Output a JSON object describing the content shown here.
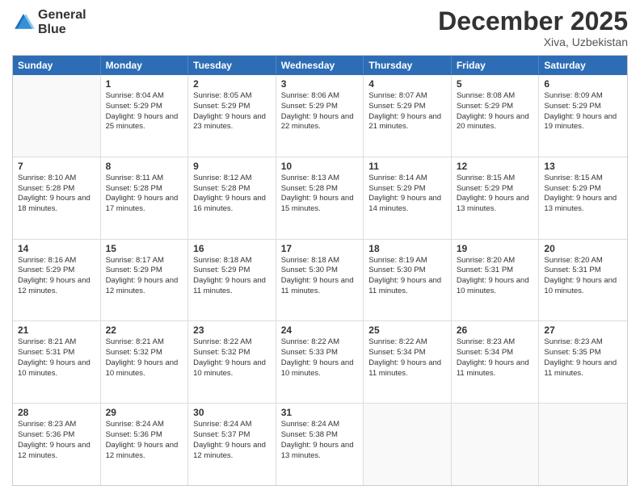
{
  "logo": {
    "line1": "General",
    "line2": "Blue"
  },
  "title": "December 2025",
  "location": "Xiva, Uzbekistan",
  "header_days": [
    "Sunday",
    "Monday",
    "Tuesday",
    "Wednesday",
    "Thursday",
    "Friday",
    "Saturday"
  ],
  "weeks": [
    [
      {
        "day": "",
        "sunrise": "",
        "sunset": "",
        "daylight": ""
      },
      {
        "day": "1",
        "sunrise": "Sunrise: 8:04 AM",
        "sunset": "Sunset: 5:29 PM",
        "daylight": "Daylight: 9 hours and 25 minutes."
      },
      {
        "day": "2",
        "sunrise": "Sunrise: 8:05 AM",
        "sunset": "Sunset: 5:29 PM",
        "daylight": "Daylight: 9 hours and 23 minutes."
      },
      {
        "day": "3",
        "sunrise": "Sunrise: 8:06 AM",
        "sunset": "Sunset: 5:29 PM",
        "daylight": "Daylight: 9 hours and 22 minutes."
      },
      {
        "day": "4",
        "sunrise": "Sunrise: 8:07 AM",
        "sunset": "Sunset: 5:29 PM",
        "daylight": "Daylight: 9 hours and 21 minutes."
      },
      {
        "day": "5",
        "sunrise": "Sunrise: 8:08 AM",
        "sunset": "Sunset: 5:29 PM",
        "daylight": "Daylight: 9 hours and 20 minutes."
      },
      {
        "day": "6",
        "sunrise": "Sunrise: 8:09 AM",
        "sunset": "Sunset: 5:29 PM",
        "daylight": "Daylight: 9 hours and 19 minutes."
      }
    ],
    [
      {
        "day": "7",
        "sunrise": "Sunrise: 8:10 AM",
        "sunset": "Sunset: 5:28 PM",
        "daylight": "Daylight: 9 hours and 18 minutes."
      },
      {
        "day": "8",
        "sunrise": "Sunrise: 8:11 AM",
        "sunset": "Sunset: 5:28 PM",
        "daylight": "Daylight: 9 hours and 17 minutes."
      },
      {
        "day": "9",
        "sunrise": "Sunrise: 8:12 AM",
        "sunset": "Sunset: 5:28 PM",
        "daylight": "Daylight: 9 hours and 16 minutes."
      },
      {
        "day": "10",
        "sunrise": "Sunrise: 8:13 AM",
        "sunset": "Sunset: 5:28 PM",
        "daylight": "Daylight: 9 hours and 15 minutes."
      },
      {
        "day": "11",
        "sunrise": "Sunrise: 8:14 AM",
        "sunset": "Sunset: 5:29 PM",
        "daylight": "Daylight: 9 hours and 14 minutes."
      },
      {
        "day": "12",
        "sunrise": "Sunrise: 8:15 AM",
        "sunset": "Sunset: 5:29 PM",
        "daylight": "Daylight: 9 hours and 13 minutes."
      },
      {
        "day": "13",
        "sunrise": "Sunrise: 8:15 AM",
        "sunset": "Sunset: 5:29 PM",
        "daylight": "Daylight: 9 hours and 13 minutes."
      }
    ],
    [
      {
        "day": "14",
        "sunrise": "Sunrise: 8:16 AM",
        "sunset": "Sunset: 5:29 PM",
        "daylight": "Daylight: 9 hours and 12 minutes."
      },
      {
        "day": "15",
        "sunrise": "Sunrise: 8:17 AM",
        "sunset": "Sunset: 5:29 PM",
        "daylight": "Daylight: 9 hours and 12 minutes."
      },
      {
        "day": "16",
        "sunrise": "Sunrise: 8:18 AM",
        "sunset": "Sunset: 5:29 PM",
        "daylight": "Daylight: 9 hours and 11 minutes."
      },
      {
        "day": "17",
        "sunrise": "Sunrise: 8:18 AM",
        "sunset": "Sunset: 5:30 PM",
        "daylight": "Daylight: 9 hours and 11 minutes."
      },
      {
        "day": "18",
        "sunrise": "Sunrise: 8:19 AM",
        "sunset": "Sunset: 5:30 PM",
        "daylight": "Daylight: 9 hours and 11 minutes."
      },
      {
        "day": "19",
        "sunrise": "Sunrise: 8:20 AM",
        "sunset": "Sunset: 5:31 PM",
        "daylight": "Daylight: 9 hours and 10 minutes."
      },
      {
        "day": "20",
        "sunrise": "Sunrise: 8:20 AM",
        "sunset": "Sunset: 5:31 PM",
        "daylight": "Daylight: 9 hours and 10 minutes."
      }
    ],
    [
      {
        "day": "21",
        "sunrise": "Sunrise: 8:21 AM",
        "sunset": "Sunset: 5:31 PM",
        "daylight": "Daylight: 9 hours and 10 minutes."
      },
      {
        "day": "22",
        "sunrise": "Sunrise: 8:21 AM",
        "sunset": "Sunset: 5:32 PM",
        "daylight": "Daylight: 9 hours and 10 minutes."
      },
      {
        "day": "23",
        "sunrise": "Sunrise: 8:22 AM",
        "sunset": "Sunset: 5:32 PM",
        "daylight": "Daylight: 9 hours and 10 minutes."
      },
      {
        "day": "24",
        "sunrise": "Sunrise: 8:22 AM",
        "sunset": "Sunset: 5:33 PM",
        "daylight": "Daylight: 9 hours and 10 minutes."
      },
      {
        "day": "25",
        "sunrise": "Sunrise: 8:22 AM",
        "sunset": "Sunset: 5:34 PM",
        "daylight": "Daylight: 9 hours and 11 minutes."
      },
      {
        "day": "26",
        "sunrise": "Sunrise: 8:23 AM",
        "sunset": "Sunset: 5:34 PM",
        "daylight": "Daylight: 9 hours and 11 minutes."
      },
      {
        "day": "27",
        "sunrise": "Sunrise: 8:23 AM",
        "sunset": "Sunset: 5:35 PM",
        "daylight": "Daylight: 9 hours and 11 minutes."
      }
    ],
    [
      {
        "day": "28",
        "sunrise": "Sunrise: 8:23 AM",
        "sunset": "Sunset: 5:36 PM",
        "daylight": "Daylight: 9 hours and 12 minutes."
      },
      {
        "day": "29",
        "sunrise": "Sunrise: 8:24 AM",
        "sunset": "Sunset: 5:36 PM",
        "daylight": "Daylight: 9 hours and 12 minutes."
      },
      {
        "day": "30",
        "sunrise": "Sunrise: 8:24 AM",
        "sunset": "Sunset: 5:37 PM",
        "daylight": "Daylight: 9 hours and 12 minutes."
      },
      {
        "day": "31",
        "sunrise": "Sunrise: 8:24 AM",
        "sunset": "Sunset: 5:38 PM",
        "daylight": "Daylight: 9 hours and 13 minutes."
      },
      {
        "day": "",
        "sunrise": "",
        "sunset": "",
        "daylight": ""
      },
      {
        "day": "",
        "sunrise": "",
        "sunset": "",
        "daylight": ""
      },
      {
        "day": "",
        "sunrise": "",
        "sunset": "",
        "daylight": ""
      }
    ]
  ]
}
